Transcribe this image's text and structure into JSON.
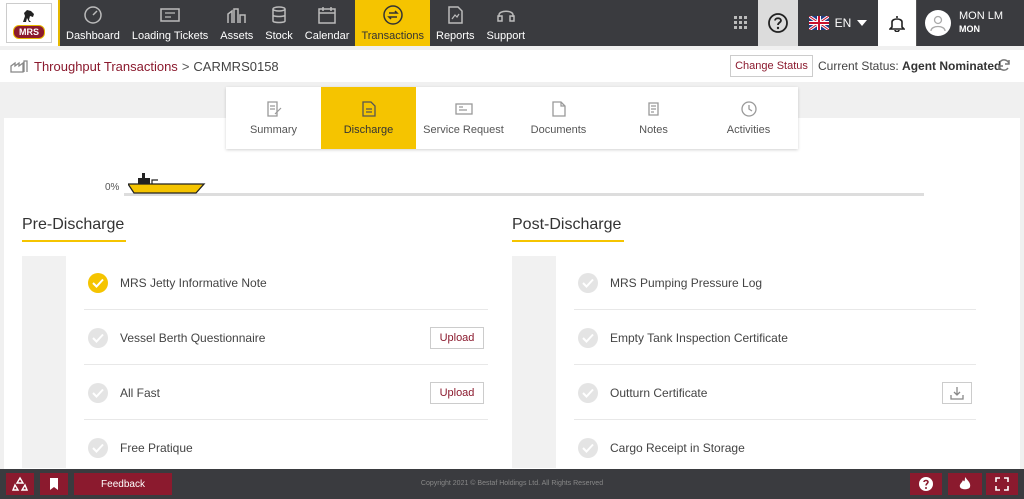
{
  "brand": {
    "name": "MRS"
  },
  "nav": [
    {
      "label": "Dashboard",
      "icon": "dashboard-icon"
    },
    {
      "label": "Loading Tickets",
      "icon": "ticket-icon"
    },
    {
      "label": "Assets",
      "icon": "assets-icon"
    },
    {
      "label": "Stock",
      "icon": "stock-icon"
    },
    {
      "label": "Calendar",
      "icon": "calendar-icon"
    },
    {
      "label": "Transactions",
      "icon": "transactions-icon",
      "active": true
    },
    {
      "label": "Reports",
      "icon": "reports-icon"
    },
    {
      "label": "Support",
      "icon": "support-icon"
    }
  ],
  "topright": {
    "language": "EN",
    "user_name": "MON LM",
    "user_sub": "MON"
  },
  "breadcrumb": {
    "parent": "Throughput Transactions",
    "separator": ">",
    "current": "CARMRS0158"
  },
  "status": {
    "change_label": "Change Status",
    "label": "Current Status:",
    "value": "Agent Nominated"
  },
  "tabs": [
    {
      "label": "Summary",
      "icon": "summary-icon"
    },
    {
      "label": "Discharge",
      "icon": "discharge-icon",
      "active": true
    },
    {
      "label": "Service Request",
      "icon": "service-request-icon"
    },
    {
      "label": "Documents",
      "icon": "documents-icon"
    },
    {
      "label": "Notes",
      "icon": "notes-icon"
    },
    {
      "label": "Activities",
      "icon": "activities-icon"
    }
  ],
  "progress": {
    "label": "0%",
    "value": 0
  },
  "pre_discharge": {
    "title": "Pre-Discharge",
    "items": [
      {
        "label": "MRS Jetty Informative Note",
        "done": true,
        "action": ""
      },
      {
        "label": "Vessel Berth Questionnaire",
        "done": false,
        "action": "Upload"
      },
      {
        "label": "All Fast",
        "done": false,
        "action": "Upload"
      },
      {
        "label": "Free Pratique",
        "done": false,
        "action": ""
      }
    ]
  },
  "post_discharge": {
    "title": "Post-Discharge",
    "items": [
      {
        "label": "MRS Pumping Pressure Log",
        "done": false,
        "action": ""
      },
      {
        "label": "Empty Tank Inspection Certificate",
        "done": false,
        "action": ""
      },
      {
        "label": "Outturn Certificate",
        "done": false,
        "action": "download"
      },
      {
        "label": "Cargo Receipt in Storage",
        "done": false,
        "action": ""
      }
    ]
  },
  "footer": {
    "feedback": "Feedback",
    "copyright": "Copyright 2021 © Bestaf Holdings Ltd. All Rights Reserved"
  },
  "colors": {
    "accent": "#f5c400",
    "brand": "#8b1a2e",
    "topbar": "#3a3b3f"
  }
}
